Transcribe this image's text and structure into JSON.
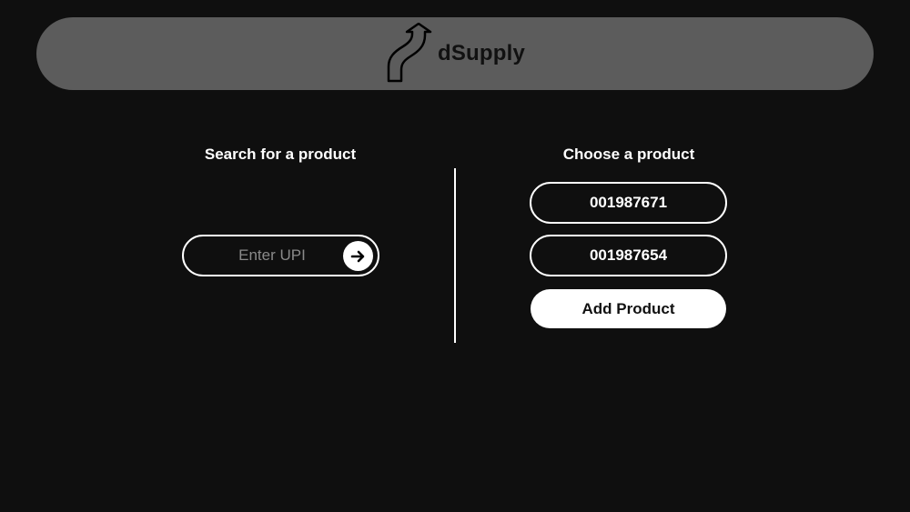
{
  "header": {
    "brand_name": "dSupply",
    "logo_icon": "curved-up-arrow-icon",
    "bar_color": "#5c5c5c"
  },
  "search": {
    "title": "Search for a product",
    "placeholder": "Enter UPI",
    "value": "",
    "submit_icon": "arrow-right-icon"
  },
  "choose": {
    "title": "Choose a product",
    "products": [
      "001987671",
      "001987654"
    ],
    "add_label": "Add Product"
  },
  "colors": {
    "background": "#0f0f0f",
    "foreground": "#ffffff"
  }
}
